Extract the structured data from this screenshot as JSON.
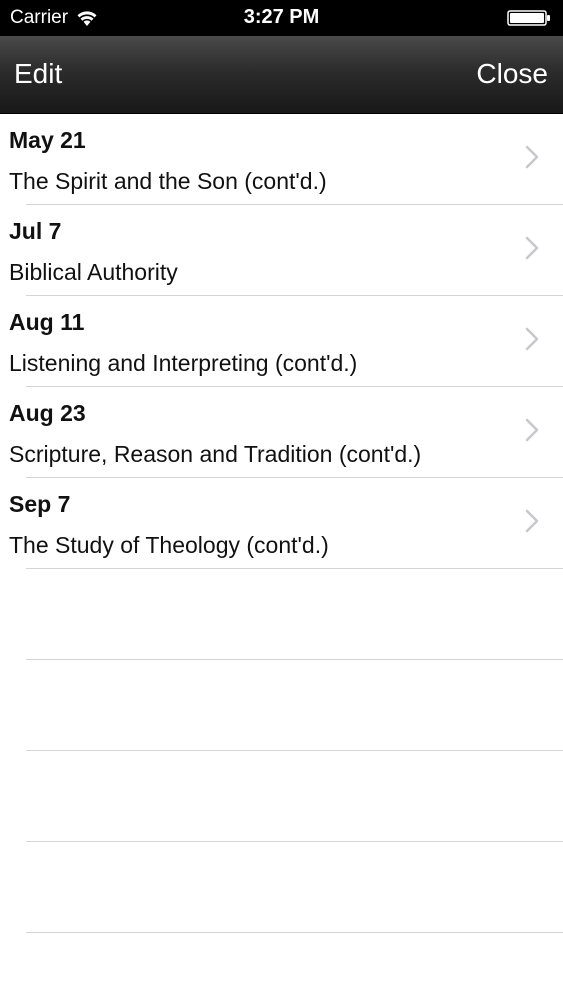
{
  "status_bar": {
    "carrier": "Carrier",
    "time": "3:27 PM",
    "icons": [
      "wifi-icon",
      "battery-icon"
    ]
  },
  "nav": {
    "left_label": "Edit",
    "right_label": "Close"
  },
  "entries": [
    {
      "date": "May 21",
      "title": "The Spirit and the Son (cont'd.)"
    },
    {
      "date": "Jul 7",
      "title": "Biblical Authority"
    },
    {
      "date": "Aug 11",
      "title": "Listening and Interpreting (cont'd.)"
    },
    {
      "date": "Aug 23",
      "title": "Scripture, Reason and Tradition (cont'd.)"
    },
    {
      "date": "Sep 7",
      "title": "The Study of Theology (cont'd.)"
    }
  ],
  "colors": {
    "nav_background": "#2c2c2c",
    "separator": "#d4d4d4",
    "chevron": "#c7c7cc"
  }
}
